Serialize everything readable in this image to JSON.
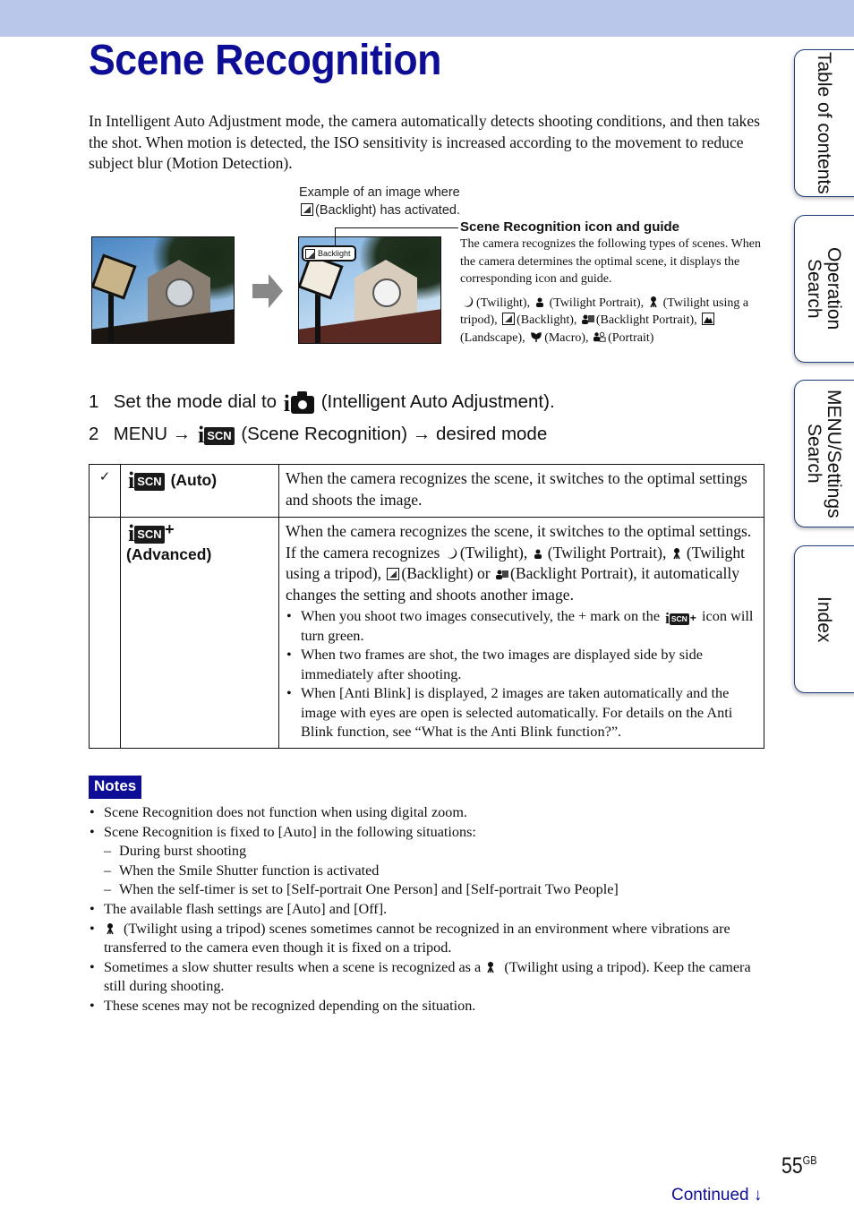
{
  "page": {
    "title": "Scene Recognition",
    "intro": "In Intelligent Auto Adjustment mode, the camera automatically detects shooting conditions, and then takes the shot. When motion is detected, the ISO sensitivity is increased according to the movement to reduce subject blur (Motion Detection).",
    "colors": {
      "accent": "#0d0d96",
      "top_bar": "#b8c7ea",
      "tab_border": "#1e3f78"
    }
  },
  "figure": {
    "caption_line1": "Example of an image where",
    "caption_line2": "(Backlight) has activated.",
    "before_image_alt": "Clock tower photo before",
    "after_image_alt": "Clock tower photo after",
    "overlay_badge": "Backlight",
    "arrow_icon": "right-arrow-icon"
  },
  "guide": {
    "heading": "Scene Recognition icon and guide",
    "description": "The camera recognizes the following types of scenes. When the camera determines the optimal scene, it displays the corresponding icon and guide.",
    "scenes": [
      {
        "icon": "twilight-icon",
        "label": "(Twilight),"
      },
      {
        "icon": "twilight-portrait-icon",
        "label": "(Twilight Portrait),"
      },
      {
        "icon": "twilight-tripod-icon",
        "label": "(Twilight using a tripod),"
      },
      {
        "icon": "backlight-icon",
        "label": "(Backlight),"
      },
      {
        "icon": "backlight-portrait-icon",
        "label": "(Backlight Portrait),"
      },
      {
        "icon": "landscape-icon",
        "label": "(Landscape),"
      },
      {
        "icon": "macro-icon",
        "label": "(Macro),"
      },
      {
        "icon": "portrait-icon",
        "label": "(Portrait)"
      }
    ]
  },
  "steps": [
    {
      "num": "1",
      "before": "Set the mode dial to",
      "icon": "intelligent-auto-icon",
      "after": "(Intelligent Auto Adjustment)."
    },
    {
      "num": "2",
      "menu": "MENU",
      "arrow": "→",
      "icon": "scene-recognition-icon",
      "middle": "(Scene Recognition)",
      "arrow2": "→",
      "after": "desired mode"
    }
  ],
  "modes": [
    {
      "checked": true,
      "check_glyph": "✓",
      "icon_text": "SCN",
      "name": "(Auto)",
      "description": "When the camera recognizes the scene, it switches to the optimal settings and shoots the image."
    },
    {
      "checked": false,
      "icon_text": "SCN",
      "icon_plus": "+",
      "name": "(Advanced)",
      "description_parts": [
        "When the camera recognizes the scene, it switches to the optimal settings. If the camera recognizes",
        "(Twilight),",
        "(Twilight Portrait),",
        "(Twilight using a tripod),",
        "(Backlight) or",
        "(Backlight Portrait), it automatically changes the setting and shoots another image."
      ],
      "bullets": [
        {
          "before": "When you shoot two images consecutively, the + mark on the",
          "after": "icon will turn green."
        },
        {
          "text": "When two frames are shot, the two images are displayed side by side immediately after shooting."
        },
        {
          "text": "When [Anti Blink] is displayed, 2 images are taken automatically and the image with eyes are open is selected automatically. For details on the Anti Blink function, see “What is the Anti Blink function?”."
        }
      ]
    }
  ],
  "notes": {
    "label": "Notes",
    "items": [
      "Scene Recognition does not function when using digital zoom.",
      "Scene Recognition is fixed to [Auto] in the following situations:",
      "The available flash settings are [Auto] and [Off].",
      "(Twilight using a tripod) scenes sometimes cannot be recognized in an environment where vibrations are transferred to the camera even though it is fixed on a tripod.",
      "Sometimes a slow shutter results when a scene is recognized as a",
      "(Twilight using a tripod). Keep the camera still during shooting.",
      "These scenes may not be recognized depending on the situation."
    ],
    "sub_items": [
      "During burst shooting",
      "When the Smile Shutter function is activated",
      "When the self-timer is set to [Self-portrait One Person] and [Self-portrait Two People]"
    ]
  },
  "side_tabs": [
    {
      "label": "Table of contents"
    },
    {
      "label": "Operation Search"
    },
    {
      "label": "MENU/Settings Search"
    },
    {
      "label": "Index"
    }
  ],
  "footer": {
    "page_number": "55",
    "page_suffix": "GB",
    "continued": "Continued",
    "continued_arrow": "↓"
  }
}
